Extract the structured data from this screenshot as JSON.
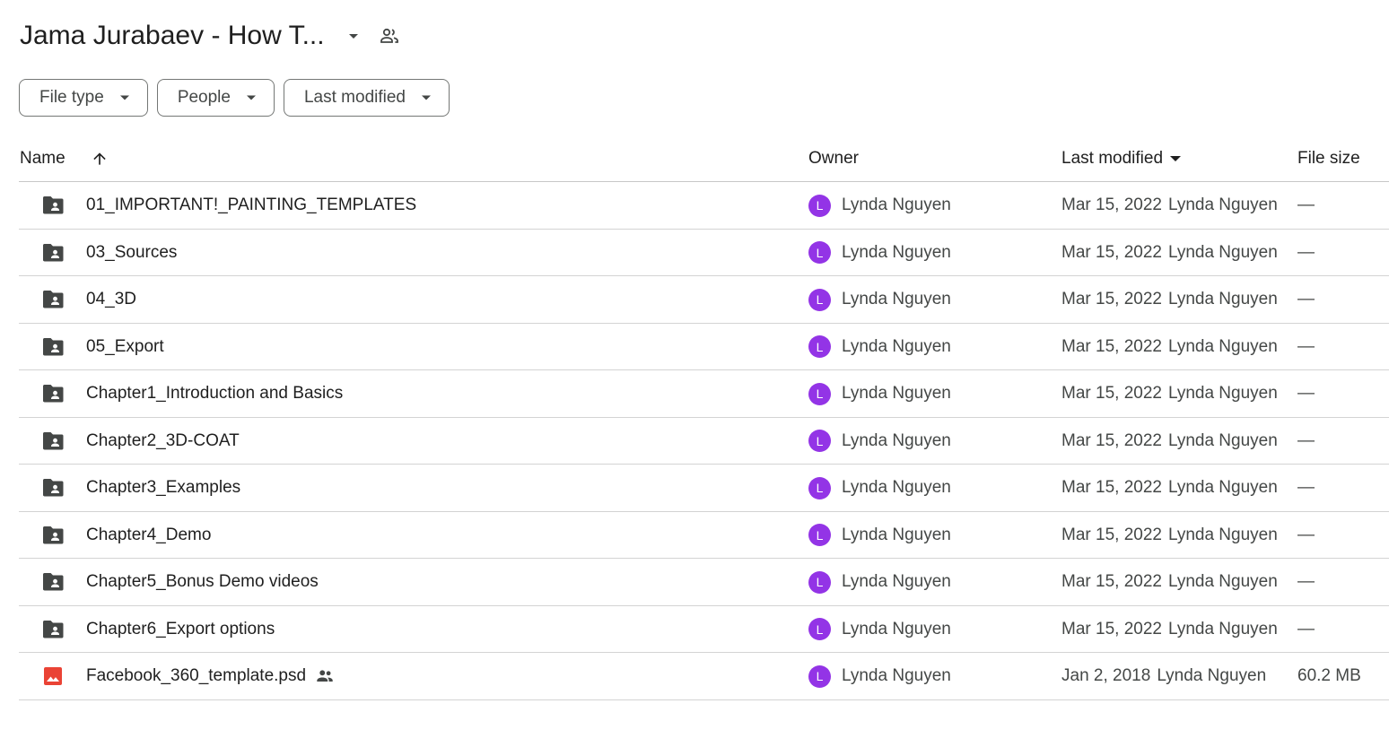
{
  "header": {
    "title": "Jama Jurabaev - How T...",
    "caret_icon": "arrow-drop-down-icon",
    "share_icon": "people-outline-icon"
  },
  "filters": [
    {
      "label": "File type"
    },
    {
      "label": "People"
    },
    {
      "label": "Last modified"
    }
  ],
  "columns": {
    "name": "Name",
    "owner": "Owner",
    "last_modified": "Last modified",
    "file_size": "File size"
  },
  "rows": [
    {
      "name": "01_IMPORTANT!_PAINTING_TEMPLATES",
      "type": "shared-folder",
      "owner": "Lynda Nguyen",
      "owner_initial": "L",
      "modified_date": "Mar 15, 2022",
      "modified_by": "Lynda Nguyen",
      "size": "—"
    },
    {
      "name": "03_Sources",
      "type": "shared-folder",
      "owner": "Lynda Nguyen",
      "owner_initial": "L",
      "modified_date": "Mar 15, 2022",
      "modified_by": "Lynda Nguyen",
      "size": "—"
    },
    {
      "name": "04_3D",
      "type": "shared-folder",
      "owner": "Lynda Nguyen",
      "owner_initial": "L",
      "modified_date": "Mar 15, 2022",
      "modified_by": "Lynda Nguyen",
      "size": "—"
    },
    {
      "name": "05_Export",
      "type": "shared-folder",
      "owner": "Lynda Nguyen",
      "owner_initial": "L",
      "modified_date": "Mar 15, 2022",
      "modified_by": "Lynda Nguyen",
      "size": "—"
    },
    {
      "name": "Chapter1_Introduction and Basics",
      "type": "shared-folder",
      "owner": "Lynda Nguyen",
      "owner_initial": "L",
      "modified_date": "Mar 15, 2022",
      "modified_by": "Lynda Nguyen",
      "size": "—"
    },
    {
      "name": "Chapter2_3D-COAT",
      "type": "shared-folder",
      "owner": "Lynda Nguyen",
      "owner_initial": "L",
      "modified_date": "Mar 15, 2022",
      "modified_by": "Lynda Nguyen",
      "size": "—"
    },
    {
      "name": "Chapter3_Examples",
      "type": "shared-folder",
      "owner": "Lynda Nguyen",
      "owner_initial": "L",
      "modified_date": "Mar 15, 2022",
      "modified_by": "Lynda Nguyen",
      "size": "—"
    },
    {
      "name": "Chapter4_Demo",
      "type": "shared-folder",
      "owner": "Lynda Nguyen",
      "owner_initial": "L",
      "modified_date": "Mar 15, 2022",
      "modified_by": "Lynda Nguyen",
      "size": "—"
    },
    {
      "name": "Chapter5_Bonus Demo videos",
      "type": "shared-folder",
      "owner": "Lynda Nguyen",
      "owner_initial": "L",
      "modified_date": "Mar 15, 2022",
      "modified_by": "Lynda Nguyen",
      "size": "—"
    },
    {
      "name": "Chapter6_Export options",
      "type": "shared-folder",
      "owner": "Lynda Nguyen",
      "owner_initial": "L",
      "modified_date": "Mar 15, 2022",
      "modified_by": "Lynda Nguyen",
      "size": "—"
    },
    {
      "name": "Facebook_360_template.psd",
      "type": "image-file",
      "shared": true,
      "owner": "Lynda Nguyen",
      "owner_initial": "L",
      "modified_date": "Jan 2, 2018",
      "modified_by": "Lynda Nguyen",
      "size": "60.2 MB"
    }
  ],
  "colors": {
    "avatar": "#9334e6",
    "folder_icon": "#444746",
    "image_icon": "#ea4335",
    "divider": "#c7c7c7"
  }
}
